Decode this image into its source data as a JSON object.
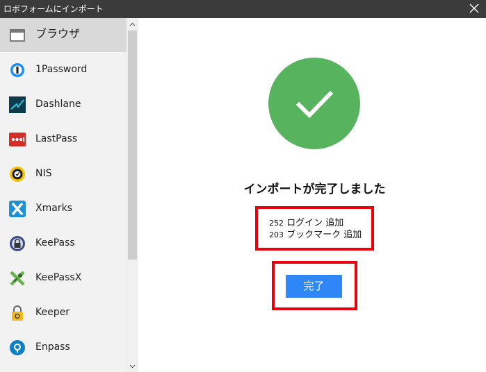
{
  "window": {
    "title": "ロボフォームにインポート"
  },
  "sidebar": {
    "items": [
      {
        "label": "ブラウザ",
        "icon": "browser-window-icon",
        "selected": true
      },
      {
        "label": "1Password",
        "icon": "1password-icon"
      },
      {
        "label": "Dashlane",
        "icon": "dashlane-icon"
      },
      {
        "label": "LastPass",
        "icon": "lastpass-icon"
      },
      {
        "label": "NIS",
        "icon": "nis-icon"
      },
      {
        "label": "Xmarks",
        "icon": "xmarks-icon"
      },
      {
        "label": "KeePass",
        "icon": "keepass-icon"
      },
      {
        "label": "KeePassX",
        "icon": "keepassx-icon"
      },
      {
        "label": "Keeper",
        "icon": "keeper-icon"
      },
      {
        "label": "Enpass",
        "icon": "enpass-icon"
      }
    ]
  },
  "main": {
    "heading": "インポートが完了しました",
    "stats": [
      {
        "count": "252",
        "text": "ログイン 追加"
      },
      {
        "count": "203",
        "text": "ブックマーク 追加"
      }
    ],
    "done_label": "完了"
  },
  "colors": {
    "success_green": "#57b35d",
    "button_blue": "#2f86f6",
    "highlight_red": "#e8000b",
    "titlebar": "#3b3b3b"
  }
}
